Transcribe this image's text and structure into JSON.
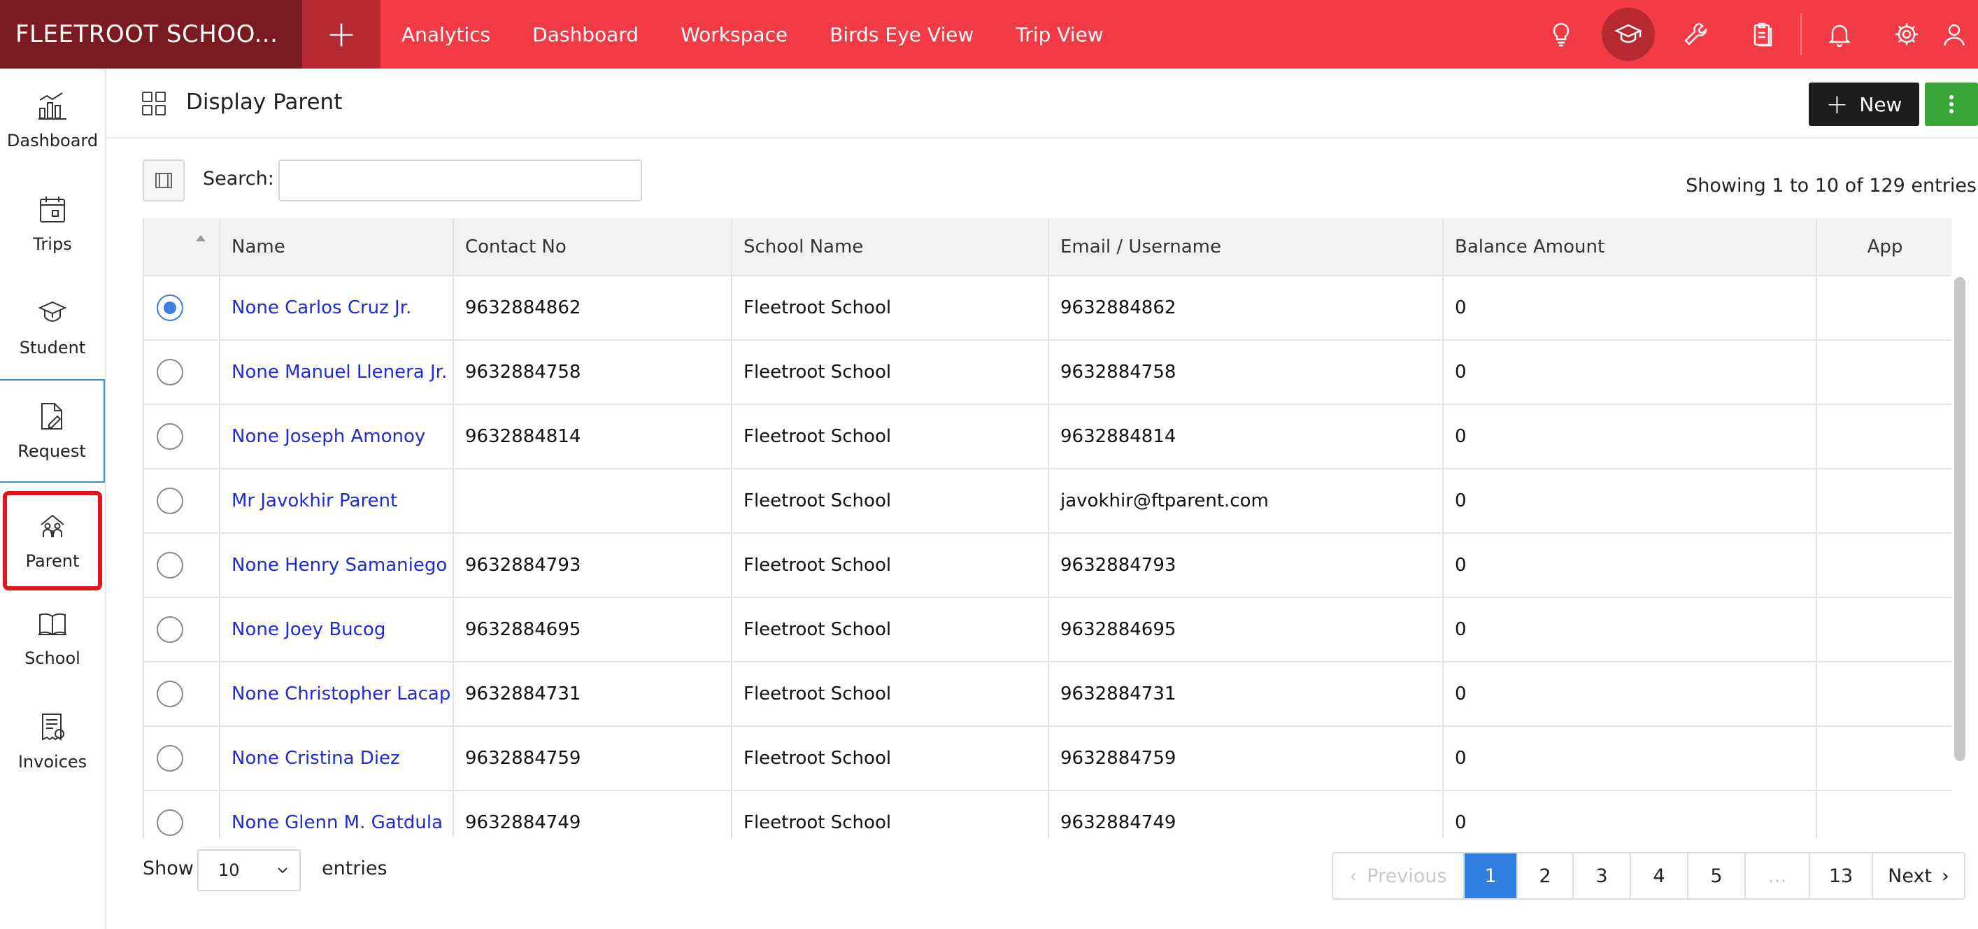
{
  "app": {
    "brand": "FLEETROOT SCHOO...",
    "add_label": "+",
    "nav": [
      "Analytics",
      "Dashboard",
      "Workspace",
      "Birds Eye View",
      "Trip View"
    ],
    "top_icons": [
      "bulb-icon",
      "graduation-cap-icon",
      "wrench-icon",
      "clipboard-icon",
      "bell-icon",
      "gear-icon",
      "user-icon"
    ]
  },
  "sidebar": {
    "items": [
      {
        "label": "Dashboard",
        "icon": "bar-chart-icon"
      },
      {
        "label": "Trips",
        "icon": "calendar-icon"
      },
      {
        "label": "Student",
        "icon": "graduation-cap-icon"
      },
      {
        "label": "Request",
        "icon": "document-edit-icon"
      },
      {
        "label": "Parent",
        "icon": "family-icon"
      },
      {
        "label": "School",
        "icon": "book-icon"
      },
      {
        "label": "Invoices",
        "icon": "invoice-icon"
      }
    ]
  },
  "header": {
    "title": "Display Parent",
    "new_label": "New"
  },
  "search": {
    "label": "Search:",
    "value": ""
  },
  "summary": "Showing 1 to 10 of 129 entries",
  "table": {
    "columns": [
      "Name",
      "Contact No",
      "School Name",
      "Email / Username",
      "Balance Amount",
      "App"
    ],
    "rows": [
      {
        "name": "None Carlos Cruz Jr.",
        "contact": "9632884862",
        "school": "Fleetroot School",
        "email": "9632884862",
        "balance": "0",
        "selected": true
      },
      {
        "name": "None Manuel Llenera Jr.",
        "contact": "9632884758",
        "school": "Fleetroot School",
        "email": "9632884758",
        "balance": "0",
        "selected": false
      },
      {
        "name": "None Joseph Amonoy",
        "contact": "9632884814",
        "school": "Fleetroot School",
        "email": "9632884814",
        "balance": "0",
        "selected": false
      },
      {
        "name": "Mr Javokhir Parent",
        "contact": "",
        "school": "Fleetroot School",
        "email": "javokhir@ftparent.com",
        "balance": "0",
        "selected": false
      },
      {
        "name": "None Henry Samaniego",
        "contact": "9632884793",
        "school": "Fleetroot School",
        "email": "9632884793",
        "balance": "0",
        "selected": false
      },
      {
        "name": "None Joey Bucog",
        "contact": "9632884695",
        "school": "Fleetroot School",
        "email": "9632884695",
        "balance": "0",
        "selected": false
      },
      {
        "name": "None Christopher Lacap",
        "contact": "9632884731",
        "school": "Fleetroot School",
        "email": "9632884731",
        "balance": "0",
        "selected": false
      },
      {
        "name": "None Cristina Diez",
        "contact": "9632884759",
        "school": "Fleetroot School",
        "email": "9632884759",
        "balance": "0",
        "selected": false
      },
      {
        "name": "None Glenn M. Gatdula",
        "contact": "9632884749",
        "school": "Fleetroot School",
        "email": "9632884749",
        "balance": "0",
        "selected": false
      }
    ]
  },
  "footer": {
    "show_label": "Show",
    "page_size": "10",
    "entries_label": "entries",
    "pagination": {
      "previous": "Previous",
      "pages": [
        "1",
        "2",
        "3",
        "4",
        "5",
        "…",
        "13"
      ],
      "current": "1",
      "next": "Next"
    }
  },
  "colors": {
    "topbar": "#f23b45",
    "brand_bg": "#7a1b21",
    "link": "#1f2bd6",
    "active_page": "#2f7fe0",
    "new_button": "#1b1d1f",
    "more_button": "#3aa63a",
    "highlight": "#e4141f"
  }
}
